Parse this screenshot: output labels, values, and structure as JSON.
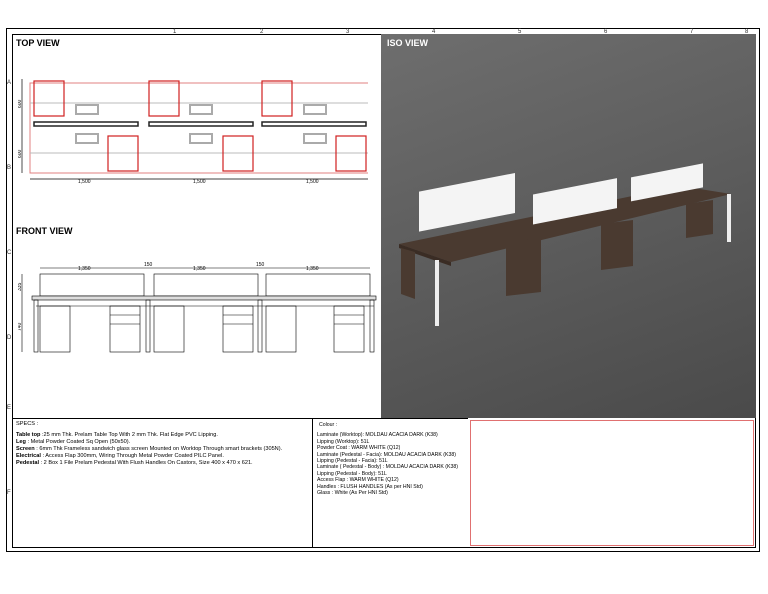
{
  "border": {
    "columns": [
      "1",
      "2",
      "3",
      "4",
      "5",
      "6",
      "7",
      "8"
    ],
    "rows": [
      "A",
      "B",
      "C",
      "D",
      "E",
      "F"
    ]
  },
  "top_view": {
    "title": "TOP VIEW",
    "dims": [
      "1,500",
      "1,500",
      "1,500"
    ],
    "depth_dims": [
      "600",
      "600"
    ]
  },
  "front_view": {
    "title": "FRONT VIEW",
    "dims": [
      "1,350",
      "150",
      "1,350",
      "150",
      "1,350"
    ],
    "height_dims": [
      "335",
      "740"
    ]
  },
  "iso_view": {
    "title": "ISO VIEW"
  },
  "specs": {
    "heading": "SPECS :",
    "lines": [
      {
        "label": "Table top",
        "text": " :25 mm Thk. Prelam Table Top With 2 mm Thk. Flat Edge PVC Lipping."
      },
      {
        "label": "Leg",
        "text": " : Metal Powder Coated Sq Open (50x50)."
      },
      {
        "label": "Screen",
        "text": " : 6mm Thk Frameless sandwich glass screen Mounted on Worktop Through smart brackets (305N)."
      },
      {
        "label": "Electrical",
        "text": " : Access Flap 300mm, Wiring Through Metal Powder Coated PILC Panel."
      },
      {
        "label": "Pedestal",
        "text": " : 2 Box 1 File Prelam Pedestal With Flush Handles On Castors, Size 400 x 470 x 621."
      }
    ]
  },
  "colour": {
    "heading": "Colour :",
    "lines": [
      "Laminate (Worktop): MOLDAU ACACIA DARK (K38)",
      "Lipping (Worktop): 51L",
      "Powder Coat : WARM WHITE (Q12)",
      "Laminate (Pedestal - Facia): MOLDAU ACACIA DARK (K38)",
      "Lipping (Pedestal - Facia): 51L",
      "Laminate ( Pedestal - Body) : MOLDAU ACACIA DARK (K38)",
      "Lipping (Pedestal - Body): 51L",
      "Access Flap : WARM WHITE (Q12)",
      "Handles : FLUSH HANDLES (As per HNI Std)",
      "Glass : White (As Per HNI Std)"
    ]
  },
  "colors": {
    "red": "#d02020",
    "wood": "#4a3a30",
    "panel": "#f4f4f4"
  }
}
